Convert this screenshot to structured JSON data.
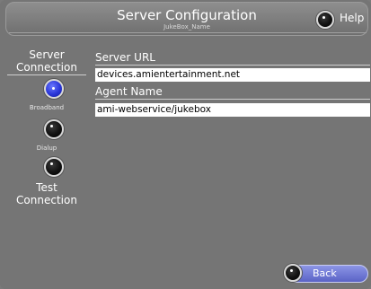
{
  "header": {
    "title": "Server Configuration",
    "subtitle": "JukeBox_Name",
    "help_label": "Help"
  },
  "left_panel": {
    "heading_line1": "Server",
    "heading_line2": "Connection",
    "options": [
      {
        "label": "Broadband",
        "selected": true
      },
      {
        "label": "Dialup",
        "selected": false
      }
    ],
    "test_line1": "Test",
    "test_line2": "Connection"
  },
  "form": {
    "server_url_label": "Server URL",
    "server_url_value": "devices.amientertainment.net",
    "agent_name_label": "Agent Name",
    "agent_name_value": "ami-webservice/jukebox"
  },
  "footer": {
    "back_label": "Back"
  },
  "colors": {
    "background": "#757575",
    "accent_blue": "#2a36d8",
    "back_button": "#7078d8"
  }
}
